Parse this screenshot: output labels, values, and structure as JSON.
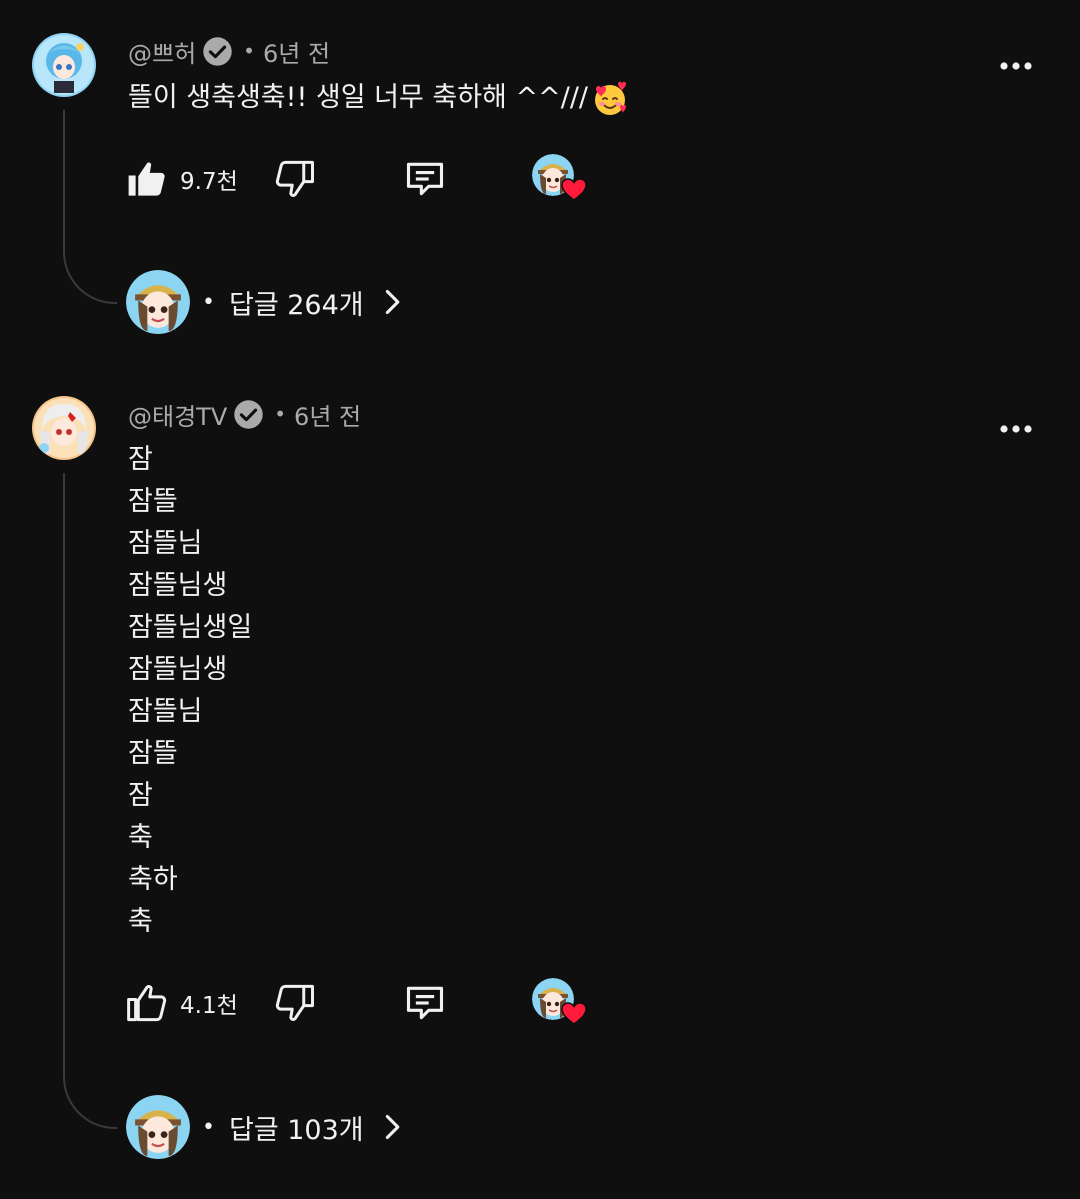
{
  "comments": [
    {
      "author": "@쁘허",
      "verified": true,
      "time": "6년 전",
      "text": "뜰이 생축생축!! 생일 너무 축하해 ^^///",
      "emoji_icon": "smiling-face-with-hearts",
      "likes": "9.7천",
      "replies_label": "답글 264개"
    },
    {
      "author": "@태경TV",
      "verified": true,
      "time": "6년 전",
      "lines": [
        "잠",
        "잠뜰",
        "잠뜰님",
        "잠뜰님생",
        "잠뜰님생일",
        "잠뜰님생",
        "잠뜰님",
        "잠뜰",
        "잠",
        "축",
        "축하",
        "축"
      ],
      "likes": "4.1천",
      "replies_label": "답글 103개"
    }
  ],
  "separator": "•",
  "icons": {
    "like": "thumbs-up-icon",
    "dislike": "thumbs-down-icon",
    "reply": "comment-icon",
    "more": "more-vert-icon",
    "creator_heart": "heart-icon",
    "verified": "verified-check-icon",
    "chevron": "chevron-right-icon"
  },
  "colors": {
    "background": "#0f0f0f",
    "text": "#f1f1f1",
    "secondary": "#aaaaaa",
    "heart": "#ff1a3a"
  }
}
